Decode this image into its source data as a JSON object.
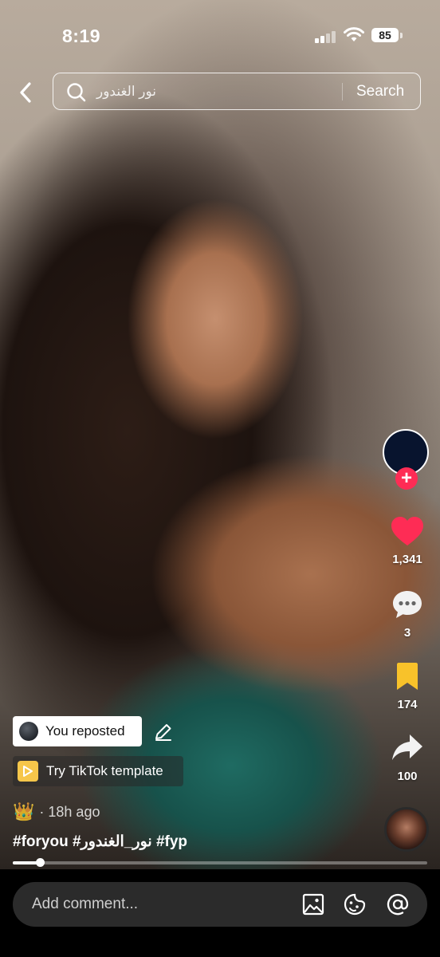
{
  "status_bar": {
    "time": "8:19",
    "battery": "85"
  },
  "search": {
    "query": "نور الغندور",
    "button_label": "Search"
  },
  "actions": {
    "likes": "1,341",
    "comments": "3",
    "saves": "174",
    "shares": "100"
  },
  "post": {
    "repost_label": "You reposted",
    "template_label": "Try TikTok template",
    "badge_emoji": "👑",
    "time_ago": "· 18h ago",
    "hashtags": "#foryou #نور_الغندور #fyp"
  },
  "progress": {
    "fraction": 0.065
  },
  "comment": {
    "placeholder": "Add comment..."
  },
  "colors": {
    "accent": "#fe2c55",
    "save": "#f8c22a",
    "template": "#f6c64a"
  }
}
